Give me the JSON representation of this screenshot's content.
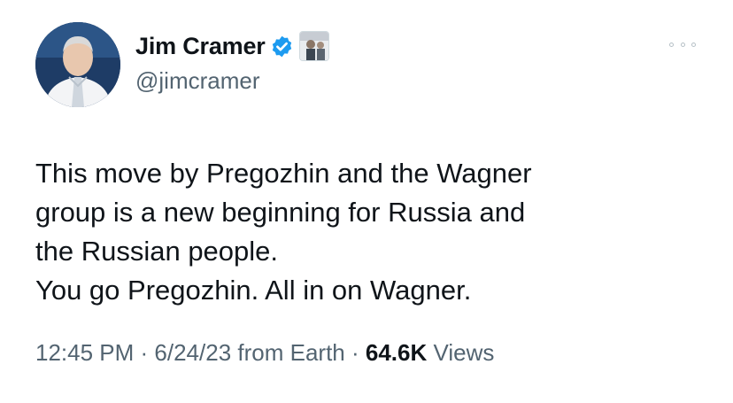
{
  "author": {
    "display_name": "Jim Cramer",
    "handle": "@jimcramer",
    "verified": true,
    "verified_color": "#1d9bf0"
  },
  "icons": {
    "avatar": "profile-photo-icon",
    "verified": "verified-checkmark-icon",
    "affiliate": "affiliate-badge-icon",
    "more": "more-options-icon"
  },
  "tweet": {
    "text": "This move by Pregozhin and the Wagner\ngroup is a new beginning for Russia and\nthe Russian people.\nYou go Pregozhin. All in on Wagner."
  },
  "meta": {
    "time": "12:45 PM",
    "separator1": " · ",
    "date": "6/24/23",
    "source": " from Earth",
    "separator2": " · ",
    "views_count": "64.6K",
    "views_label": " Views"
  }
}
